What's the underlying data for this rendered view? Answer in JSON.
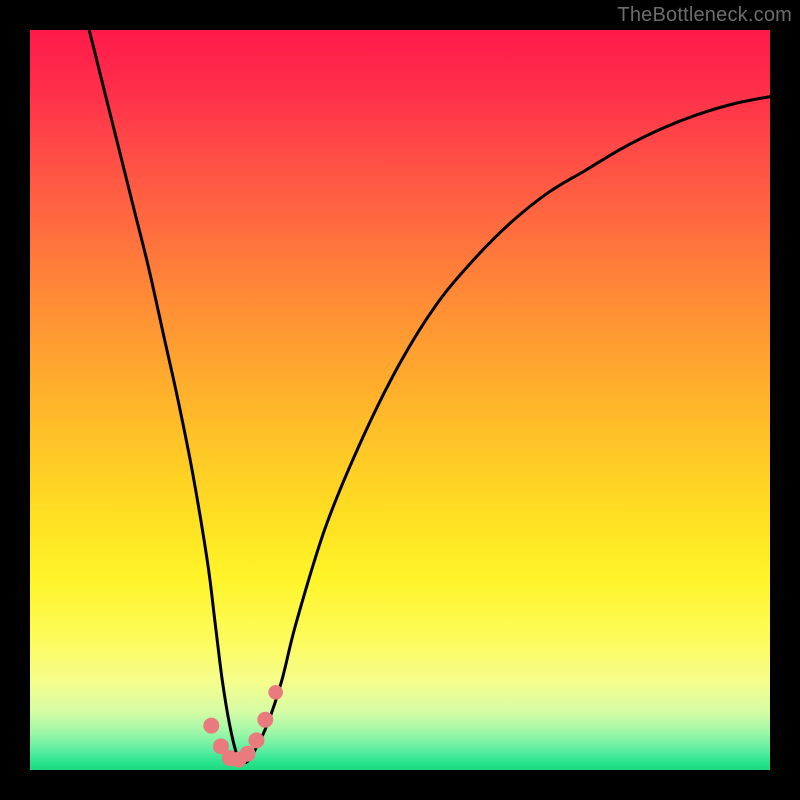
{
  "watermark": "TheBottleneck.com",
  "chart_data": {
    "type": "line",
    "title": "",
    "xlabel": "",
    "ylabel": "",
    "xlim": [
      0,
      100
    ],
    "ylim": [
      0,
      100
    ],
    "series": [
      {
        "name": "bottleneck-curve",
        "x": [
          8,
          10,
          12,
          14,
          16,
          18,
          20,
          22,
          24,
          25,
          26,
          27,
          28,
          29,
          30,
          32,
          34,
          36,
          40,
          45,
          50,
          55,
          60,
          65,
          70,
          75,
          80,
          85,
          90,
          95,
          100
        ],
        "values": [
          100,
          92,
          84,
          76,
          68,
          59,
          50,
          40,
          28,
          20,
          12,
          6,
          2,
          1,
          2,
          6,
          12,
          20,
          33,
          45,
          55,
          63,
          69,
          74,
          78,
          81,
          84,
          86.5,
          88.5,
          90,
          91
        ]
      }
    ],
    "markers": {
      "name": "highlight-dots",
      "color": "#e97a7d",
      "points": [
        {
          "x": 24.5,
          "y": 6.0,
          "r": 1.2
        },
        {
          "x": 25.8,
          "y": 3.2,
          "r": 1.2
        },
        {
          "x": 27.0,
          "y": 1.6,
          "r": 1.2
        },
        {
          "x": 28.2,
          "y": 1.4,
          "r": 1.2
        },
        {
          "x": 29.4,
          "y": 2.2,
          "r": 1.2
        },
        {
          "x": 30.6,
          "y": 4.0,
          "r": 1.2
        },
        {
          "x": 31.8,
          "y": 6.8,
          "r": 1.2
        },
        {
          "x": 33.2,
          "y": 10.5,
          "r": 1.1
        }
      ]
    }
  }
}
